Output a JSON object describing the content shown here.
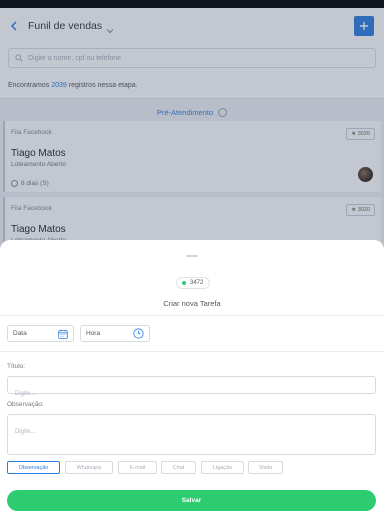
{
  "header": {
    "title": "Funil de vendas",
    "search_placeholder": "Digite o nome, cpf ou telefone"
  },
  "summary": {
    "prefix": "Encontramos",
    "count": "2039",
    "suffix": "registros nessa etapa."
  },
  "stage": {
    "label": "Pré-Atendimento"
  },
  "cards": [
    {
      "source": "Fila Facebook",
      "badge": "3020",
      "name": "Tiago Matos",
      "subtitle": "Loteamento Aberto",
      "time": "8 dias (S)"
    },
    {
      "source": "Fila Facebook",
      "badge": "3020",
      "name": "Tiago Matos",
      "subtitle": "Loteamento Aberto"
    }
  ],
  "sheet": {
    "counter": "3472",
    "title": "Criar nova Tarefa",
    "date_placeholder": "Data",
    "time_placeholder": "Hora",
    "title_label": "Título:",
    "title_placeholder": "Digite...",
    "obs_label": "Observação:",
    "obs_placeholder": "Digite...",
    "types": [
      "Observação",
      "Whatsapp",
      "E-mail",
      "Chat",
      "Ligação",
      "Visita"
    ],
    "active_type": "Observação",
    "save_label": "Salvar"
  },
  "colors": {
    "accent": "#2b7de1",
    "success": "#2ecc71"
  }
}
